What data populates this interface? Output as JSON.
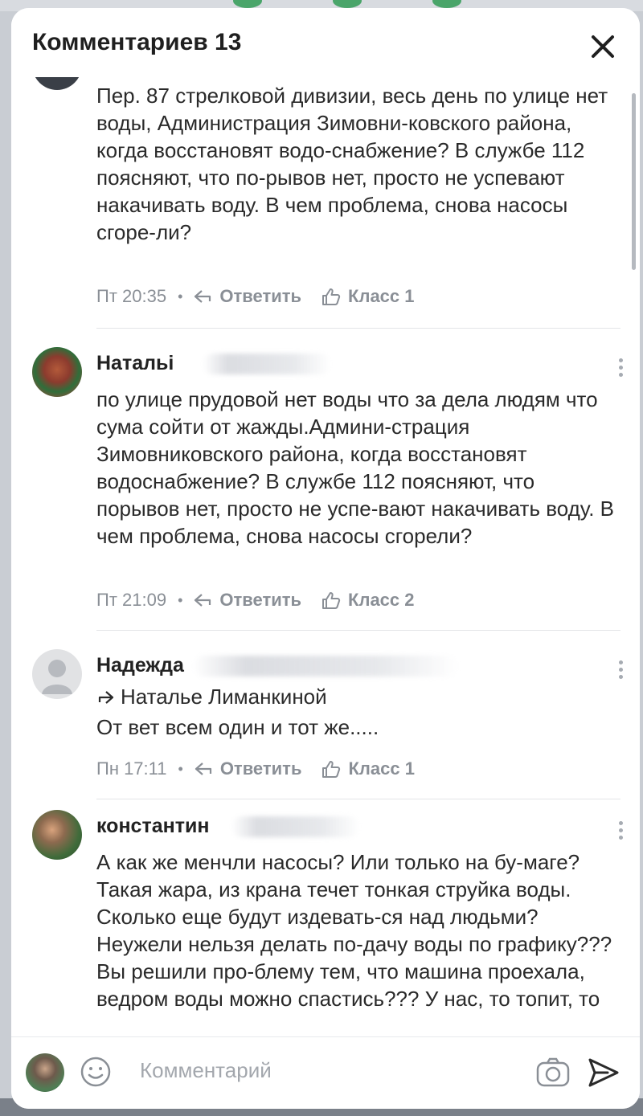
{
  "header": {
    "title": "Комментариев 13"
  },
  "comments": [
    {
      "text": "Пер. 87 стрелковой дивизии, весь день по улице нет воды, Администрация Зимовни-ковского района, когда восстановят водо-снабжение? В службе 112 поясняют, что по-рывов нет, просто не успевают накачивать воду. В чем проблема, снова насосы сгоре-ли?",
      "time": "Пт 20:35",
      "reply_label": "Ответить",
      "like_label": "Класс 1"
    },
    {
      "author": "Натальі",
      "text": "по улице прудовой нет воды что за дела людям что сума сойти от жажды.Админи-страция Зимовниковского района, когда восстановят водоснабжение? В службе 112 поясняют, что порывов нет, просто не успе-вают накачивать воду. В чем проблема, снова насосы сгорели?",
      "time": "Пт 21:09",
      "reply_label": "Ответить",
      "like_label": "Класс 2"
    },
    {
      "author": "Надежда",
      "reply_to": "Наталье Лиманкиной",
      "text": "От вет всем один и тот же.....",
      "time": "Пн 17:11",
      "reply_label": "Ответить",
      "like_label": "Класс 1"
    },
    {
      "author": "константин",
      "text": "А как же менчли насосы? Или только на бу-маге? Такая жара, из крана течет тонкая струйка воды. Сколько еще будут издевать-ся над людьми? Неужели нельзя делать по-дачу воды по графику??? Вы решили про-блему тем, что машина проехала, ведром воды можно спастись??? У нас, то топит, то"
    }
  ],
  "footer": {
    "placeholder": "Комментарий"
  },
  "colors": {
    "text": "#2a2a2a",
    "meta": "#8a8f96",
    "accent": "#1f1f1f"
  }
}
